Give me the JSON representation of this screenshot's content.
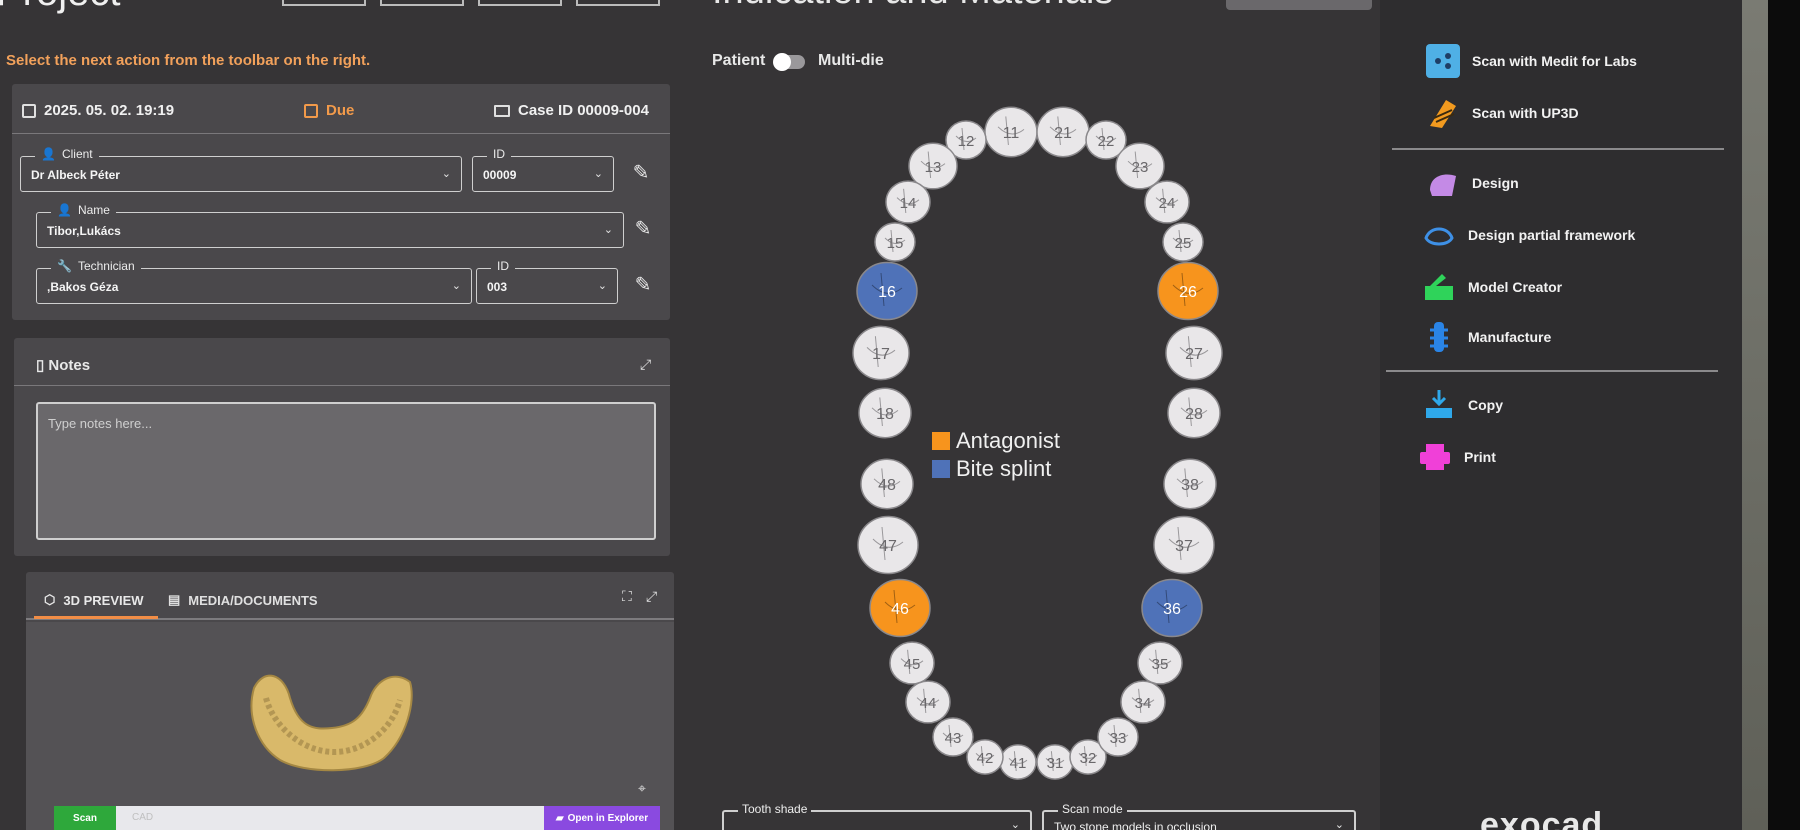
{
  "header": {
    "project_title": "Project",
    "indication_title": "Indication and Materials",
    "hint": "Select the next action from the toolbar on the right."
  },
  "info": {
    "date": "2025. 05. 02. 19:19",
    "due": "Due",
    "case_id": "Case ID 00009-004",
    "client_label": "Client",
    "client_value": "Dr Albeck Péter",
    "client_id_label": "ID",
    "client_id_value": "00009",
    "name_label": "Name",
    "name_value": "Tibor,Lukács",
    "technician_label": "Technician",
    "technician_value": ",Bakos Géza",
    "technician_id_label": "ID",
    "technician_id_value": "003"
  },
  "notes": {
    "title": "Notes",
    "placeholder": "Type notes here..."
  },
  "preview": {
    "tab_3d": "3D PREVIEW",
    "tab_media": "MEDIA/DOCUMENTS",
    "scan_label": "Scan",
    "cad_label": "CAD",
    "open_explorer": "Open in Explorer"
  },
  "toggle": {
    "left": "Patient",
    "right": "Multi-die"
  },
  "legend": {
    "antagonist": "Antagonist",
    "bite_splint": "Bite splint"
  },
  "colors": {
    "antagonist": "#f7941d",
    "bite_splint": "#4f72b8",
    "tooth": "#e9e7e9",
    "accent": "#f2a15b"
  },
  "teeth": [
    {
      "n": "11",
      "s": ""
    },
    {
      "n": "12",
      "s": ""
    },
    {
      "n": "13",
      "s": ""
    },
    {
      "n": "14",
      "s": ""
    },
    {
      "n": "15",
      "s": ""
    },
    {
      "n": "16",
      "s": "bite_splint"
    },
    {
      "n": "17",
      "s": ""
    },
    {
      "n": "18",
      "s": ""
    },
    {
      "n": "21",
      "s": ""
    },
    {
      "n": "22",
      "s": ""
    },
    {
      "n": "23",
      "s": ""
    },
    {
      "n": "24",
      "s": ""
    },
    {
      "n": "25",
      "s": ""
    },
    {
      "n": "26",
      "s": "antagonist"
    },
    {
      "n": "27",
      "s": ""
    },
    {
      "n": "28",
      "s": ""
    },
    {
      "n": "31",
      "s": ""
    },
    {
      "n": "32",
      "s": ""
    },
    {
      "n": "33",
      "s": ""
    },
    {
      "n": "34",
      "s": ""
    },
    {
      "n": "35",
      "s": ""
    },
    {
      "n": "36",
      "s": "bite_splint"
    },
    {
      "n": "37",
      "s": ""
    },
    {
      "n": "38",
      "s": ""
    },
    {
      "n": "41",
      "s": ""
    },
    {
      "n": "42",
      "s": ""
    },
    {
      "n": "43",
      "s": ""
    },
    {
      "n": "44",
      "s": ""
    },
    {
      "n": "45",
      "s": ""
    },
    {
      "n": "46",
      "s": "antagonist"
    },
    {
      "n": "47",
      "s": ""
    },
    {
      "n": "48",
      "s": ""
    }
  ],
  "bottom": {
    "tooth_shade_label": "Tooth shade",
    "scan_mode_label": "Scan mode",
    "scan_mode_value": "Two stone models in occlusion"
  },
  "sidebar": {
    "scan_medit": "Scan with Medit for Labs",
    "scan_up3d": "Scan with UP3D",
    "design": "Design",
    "design_partial": "Design partial framework",
    "model_creator": "Model Creator",
    "manufacture": "Manufacture",
    "copy": "Copy",
    "print": "Print",
    "brand": "exocad"
  }
}
